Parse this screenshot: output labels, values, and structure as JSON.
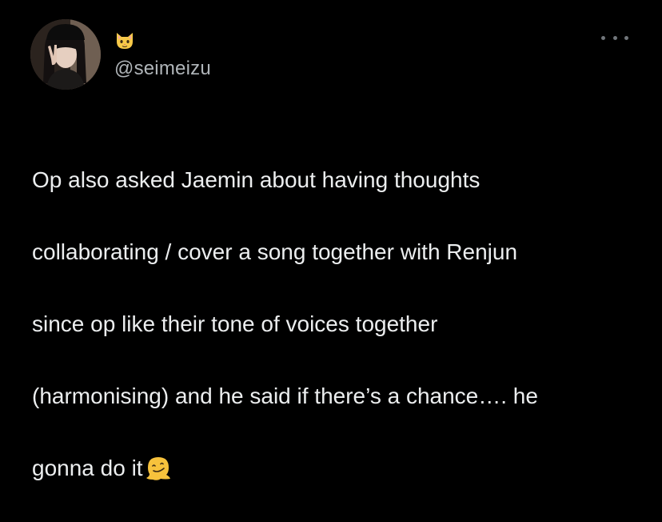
{
  "tweet": {
    "display_name_icon": "cat-face-emoji-icon",
    "handle": "@seimeizu",
    "more_icon": "more-options-icon",
    "lines": [
      "Op also asked Jaemin about having thoughts",
      "collaborating / cover a song together with Renjun",
      "since op like their tone of voices together",
      "(harmonising) and he said if there’s a chance…. he",
      "gonna do it"
    ],
    "trailing_emoji_icon": "melting-face-emoji-icon"
  },
  "colors": {
    "background": "#000000",
    "text": "#eceeef",
    "handle": "#b0b5b9",
    "icon_muted": "#71767b"
  }
}
